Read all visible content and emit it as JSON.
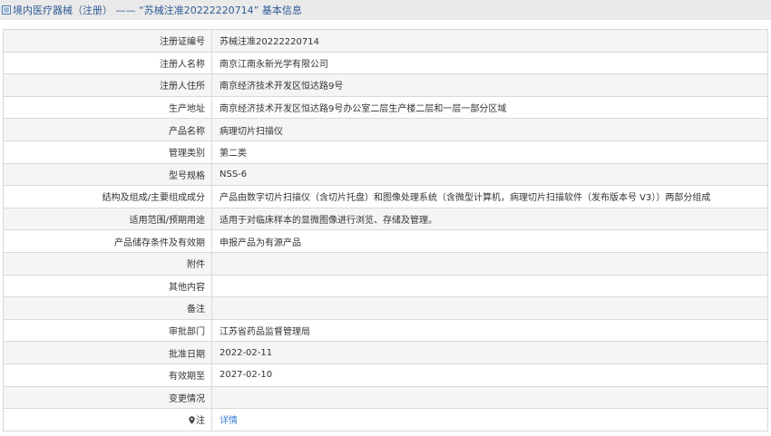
{
  "header": {
    "title": "境内医疗器械（注册） —— “苏械注准20222220714” 基本信息"
  },
  "rows": [
    {
      "label": "注册证编号",
      "value": "苏械注准20222220714"
    },
    {
      "label": "注册人名称",
      "value": "南京江南永新光学有限公司"
    },
    {
      "label": "注册人住所",
      "value": "南京经济技术开发区恒达路9号"
    },
    {
      "label": "生产地址",
      "value": "南京经济技术开发区恒达路9号办公室二层生产楼二层和一层一部分区域"
    },
    {
      "label": "产品名称",
      "value": "病理切片扫描仪"
    },
    {
      "label": "管理类别",
      "value": "第二类"
    },
    {
      "label": "型号规格",
      "value": "NSS-6"
    },
    {
      "label": "结构及组成/主要组成成分",
      "value": "产品由数字切片扫描仪（含切片托盘）和图像处理系统（含微型计算机，病理切片扫描软件（发布版本号 V3））两部分组成"
    },
    {
      "label": "适用范围/预期用途",
      "value": "适用于对临床样本的显微图像进行浏览、存储及管理。"
    },
    {
      "label": "产品储存条件及有效期",
      "value": "申报产品为有源产品"
    },
    {
      "label": "附件",
      "value": ""
    },
    {
      "label": "其他内容",
      "value": ""
    },
    {
      "label": "备注",
      "value": ""
    },
    {
      "label": "审批部门",
      "value": "江苏省药品监督管理局"
    },
    {
      "label": "批准日期",
      "value": "2022-02-11"
    },
    {
      "label": "有效期至",
      "value": "2027-02-10"
    },
    {
      "label": "变更情况",
      "value": ""
    }
  ],
  "note_row": {
    "label": "注",
    "link_text": "详情",
    "icon": "location-pin-icon"
  },
  "colors": {
    "header_bg": "#eaeaea",
    "title": "#2e5b96",
    "link": "#3b7fd6",
    "border": "#d9d9d9",
    "row_alt": "#f5f5f5"
  }
}
